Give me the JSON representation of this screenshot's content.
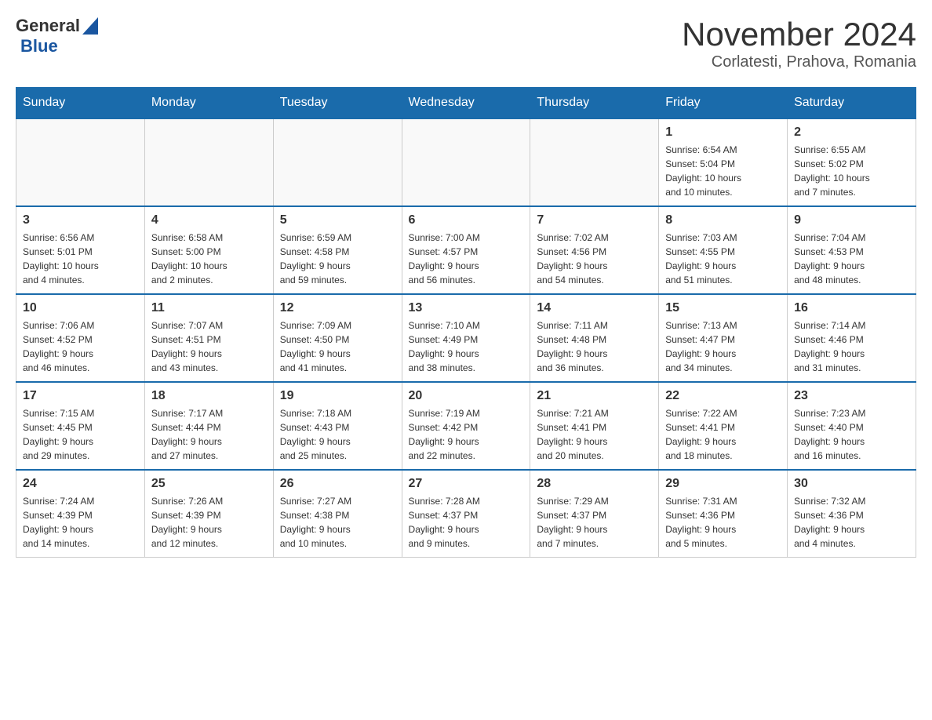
{
  "header": {
    "logo": {
      "text_general": "General",
      "triangle_color": "#1a56a0",
      "text_blue": "Blue"
    },
    "title": "November 2024",
    "subtitle": "Corlatesti, Prahova, Romania"
  },
  "calendar": {
    "days_of_week": [
      "Sunday",
      "Monday",
      "Tuesday",
      "Wednesday",
      "Thursday",
      "Friday",
      "Saturday"
    ],
    "weeks": [
      {
        "days": [
          {
            "number": "",
            "info": ""
          },
          {
            "number": "",
            "info": ""
          },
          {
            "number": "",
            "info": ""
          },
          {
            "number": "",
            "info": ""
          },
          {
            "number": "",
            "info": ""
          },
          {
            "number": "1",
            "info": "Sunrise: 6:54 AM\nSunset: 5:04 PM\nDaylight: 10 hours\nand 10 minutes."
          },
          {
            "number": "2",
            "info": "Sunrise: 6:55 AM\nSunset: 5:02 PM\nDaylight: 10 hours\nand 7 minutes."
          }
        ]
      },
      {
        "days": [
          {
            "number": "3",
            "info": "Sunrise: 6:56 AM\nSunset: 5:01 PM\nDaylight: 10 hours\nand 4 minutes."
          },
          {
            "number": "4",
            "info": "Sunrise: 6:58 AM\nSunset: 5:00 PM\nDaylight: 10 hours\nand 2 minutes."
          },
          {
            "number": "5",
            "info": "Sunrise: 6:59 AM\nSunset: 4:58 PM\nDaylight: 9 hours\nand 59 minutes."
          },
          {
            "number": "6",
            "info": "Sunrise: 7:00 AM\nSunset: 4:57 PM\nDaylight: 9 hours\nand 56 minutes."
          },
          {
            "number": "7",
            "info": "Sunrise: 7:02 AM\nSunset: 4:56 PM\nDaylight: 9 hours\nand 54 minutes."
          },
          {
            "number": "8",
            "info": "Sunrise: 7:03 AM\nSunset: 4:55 PM\nDaylight: 9 hours\nand 51 minutes."
          },
          {
            "number": "9",
            "info": "Sunrise: 7:04 AM\nSunset: 4:53 PM\nDaylight: 9 hours\nand 48 minutes."
          }
        ]
      },
      {
        "days": [
          {
            "number": "10",
            "info": "Sunrise: 7:06 AM\nSunset: 4:52 PM\nDaylight: 9 hours\nand 46 minutes."
          },
          {
            "number": "11",
            "info": "Sunrise: 7:07 AM\nSunset: 4:51 PM\nDaylight: 9 hours\nand 43 minutes."
          },
          {
            "number": "12",
            "info": "Sunrise: 7:09 AM\nSunset: 4:50 PM\nDaylight: 9 hours\nand 41 minutes."
          },
          {
            "number": "13",
            "info": "Sunrise: 7:10 AM\nSunset: 4:49 PM\nDaylight: 9 hours\nand 38 minutes."
          },
          {
            "number": "14",
            "info": "Sunrise: 7:11 AM\nSunset: 4:48 PM\nDaylight: 9 hours\nand 36 minutes."
          },
          {
            "number": "15",
            "info": "Sunrise: 7:13 AM\nSunset: 4:47 PM\nDaylight: 9 hours\nand 34 minutes."
          },
          {
            "number": "16",
            "info": "Sunrise: 7:14 AM\nSunset: 4:46 PM\nDaylight: 9 hours\nand 31 minutes."
          }
        ]
      },
      {
        "days": [
          {
            "number": "17",
            "info": "Sunrise: 7:15 AM\nSunset: 4:45 PM\nDaylight: 9 hours\nand 29 minutes."
          },
          {
            "number": "18",
            "info": "Sunrise: 7:17 AM\nSunset: 4:44 PM\nDaylight: 9 hours\nand 27 minutes."
          },
          {
            "number": "19",
            "info": "Sunrise: 7:18 AM\nSunset: 4:43 PM\nDaylight: 9 hours\nand 25 minutes."
          },
          {
            "number": "20",
            "info": "Sunrise: 7:19 AM\nSunset: 4:42 PM\nDaylight: 9 hours\nand 22 minutes."
          },
          {
            "number": "21",
            "info": "Sunrise: 7:21 AM\nSunset: 4:41 PM\nDaylight: 9 hours\nand 20 minutes."
          },
          {
            "number": "22",
            "info": "Sunrise: 7:22 AM\nSunset: 4:41 PM\nDaylight: 9 hours\nand 18 minutes."
          },
          {
            "number": "23",
            "info": "Sunrise: 7:23 AM\nSunset: 4:40 PM\nDaylight: 9 hours\nand 16 minutes."
          }
        ]
      },
      {
        "days": [
          {
            "number": "24",
            "info": "Sunrise: 7:24 AM\nSunset: 4:39 PM\nDaylight: 9 hours\nand 14 minutes."
          },
          {
            "number": "25",
            "info": "Sunrise: 7:26 AM\nSunset: 4:39 PM\nDaylight: 9 hours\nand 12 minutes."
          },
          {
            "number": "26",
            "info": "Sunrise: 7:27 AM\nSunset: 4:38 PM\nDaylight: 9 hours\nand 10 minutes."
          },
          {
            "number": "27",
            "info": "Sunrise: 7:28 AM\nSunset: 4:37 PM\nDaylight: 9 hours\nand 9 minutes."
          },
          {
            "number": "28",
            "info": "Sunrise: 7:29 AM\nSunset: 4:37 PM\nDaylight: 9 hours\nand 7 minutes."
          },
          {
            "number": "29",
            "info": "Sunrise: 7:31 AM\nSunset: 4:36 PM\nDaylight: 9 hours\nand 5 minutes."
          },
          {
            "number": "30",
            "info": "Sunrise: 7:32 AM\nSunset: 4:36 PM\nDaylight: 9 hours\nand 4 minutes."
          }
        ]
      }
    ]
  }
}
